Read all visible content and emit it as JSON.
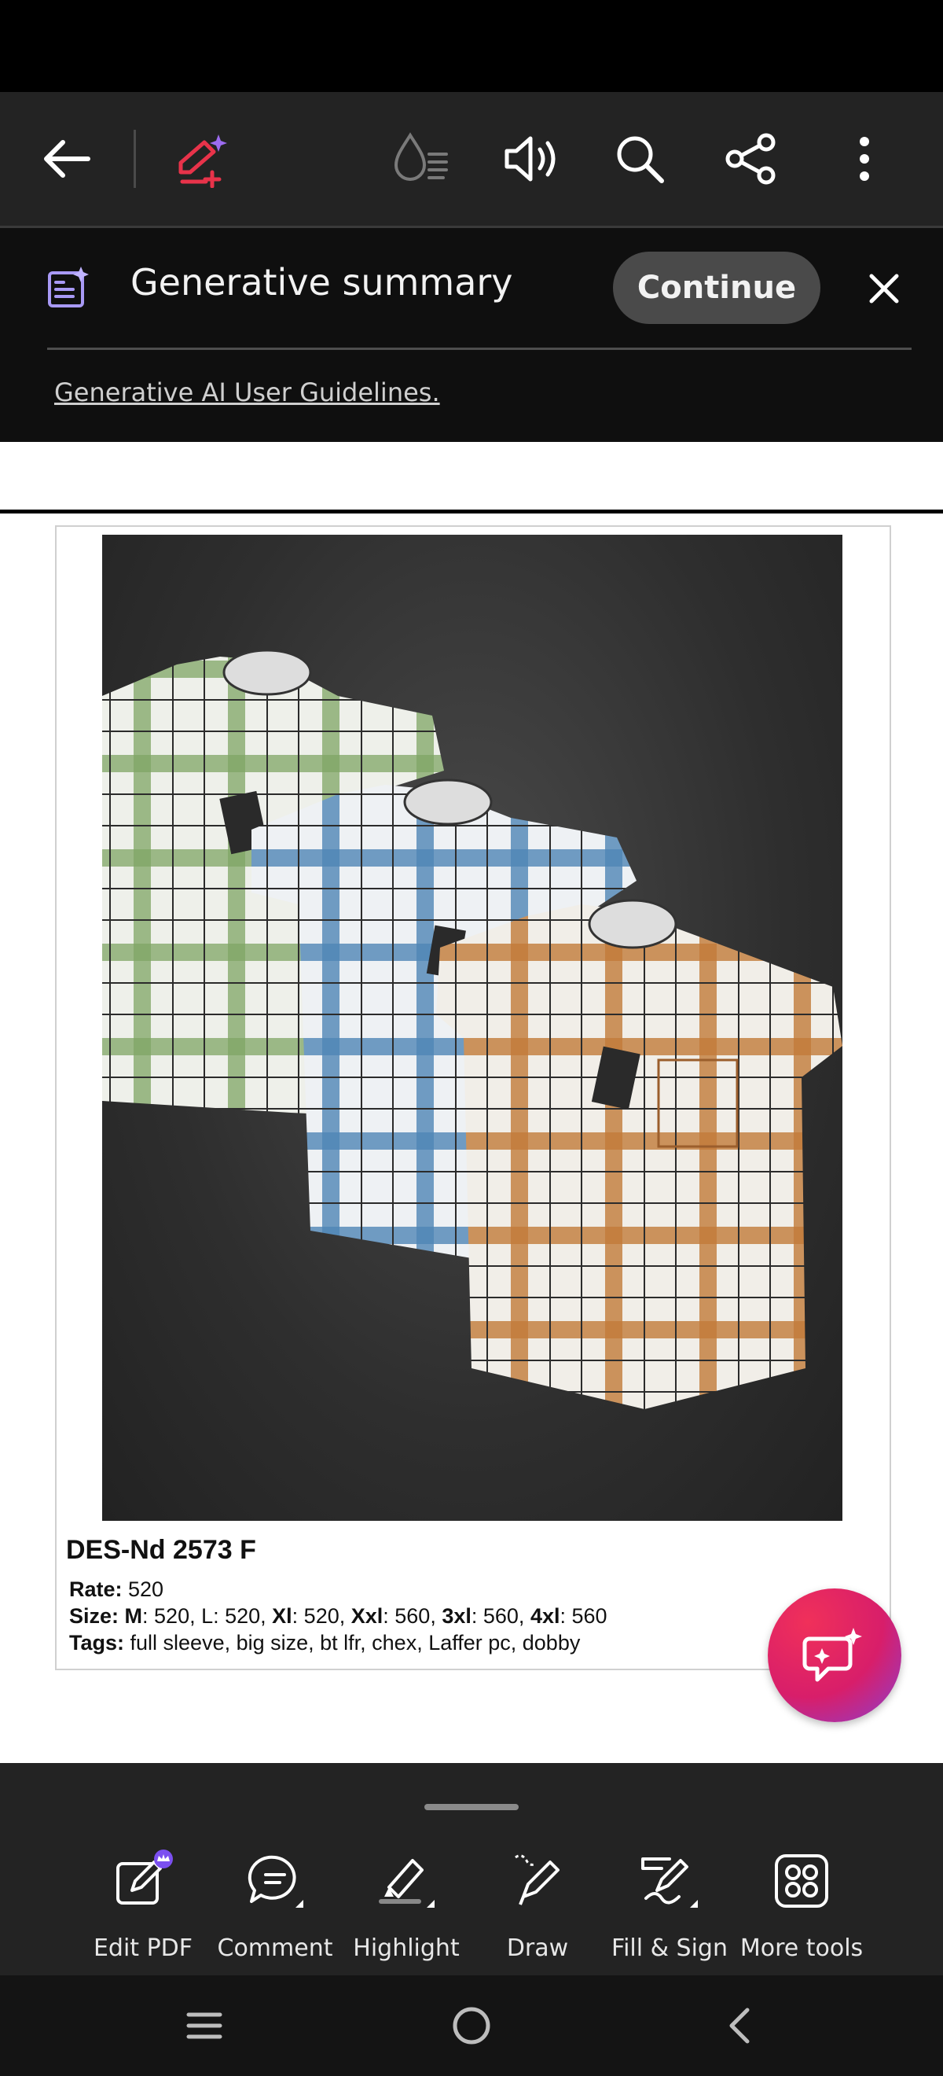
{
  "toolbar": {
    "icons": [
      "back-arrow-icon",
      "ai-assistant-icon",
      "liquid-mode-icon",
      "read-aloud-icon",
      "search-icon",
      "share-icon",
      "more-options-icon"
    ]
  },
  "generative_summary": {
    "title": "Generative summary",
    "continue_label": "Continue",
    "guidelines_link": "Generative AI User Guidelines."
  },
  "document": {
    "product_code": "DES-Nd 2573 F",
    "rate_label": "Rate:",
    "rate_value": " 520",
    "size_label": "Size:",
    "size_m_label": " M",
    "size_m_value": ": 520, L: 520, ",
    "size_xl_label": "Xl",
    "size_xl_value": ": 520, ",
    "size_xxl_label": "Xxl",
    "size_xxl_value": ": 560, ",
    "size_3xl_label": "3xl",
    "size_3xl_value": ": 560, ",
    "size_4xl_label": "4xl",
    "size_4xl_value": ": 560",
    "tags_label": "Tags:",
    "tags_value": " full sleeve, big size, bt lfr, chex, Laffer pc, dobby"
  },
  "bottom_tools": [
    {
      "label": "Edit PDF"
    },
    {
      "label": "Comment"
    },
    {
      "label": "Highlight"
    },
    {
      "label": "Draw"
    },
    {
      "label": "Fill & Sign"
    },
    {
      "label": "More tools"
    }
  ],
  "colors": {
    "brand_red": "#e8334a",
    "ai_purple": "#7b6cf0",
    "shirt_green": "#7fa564",
    "shirt_blue": "#4f86b5",
    "shirt_orange": "#c27a3a"
  }
}
